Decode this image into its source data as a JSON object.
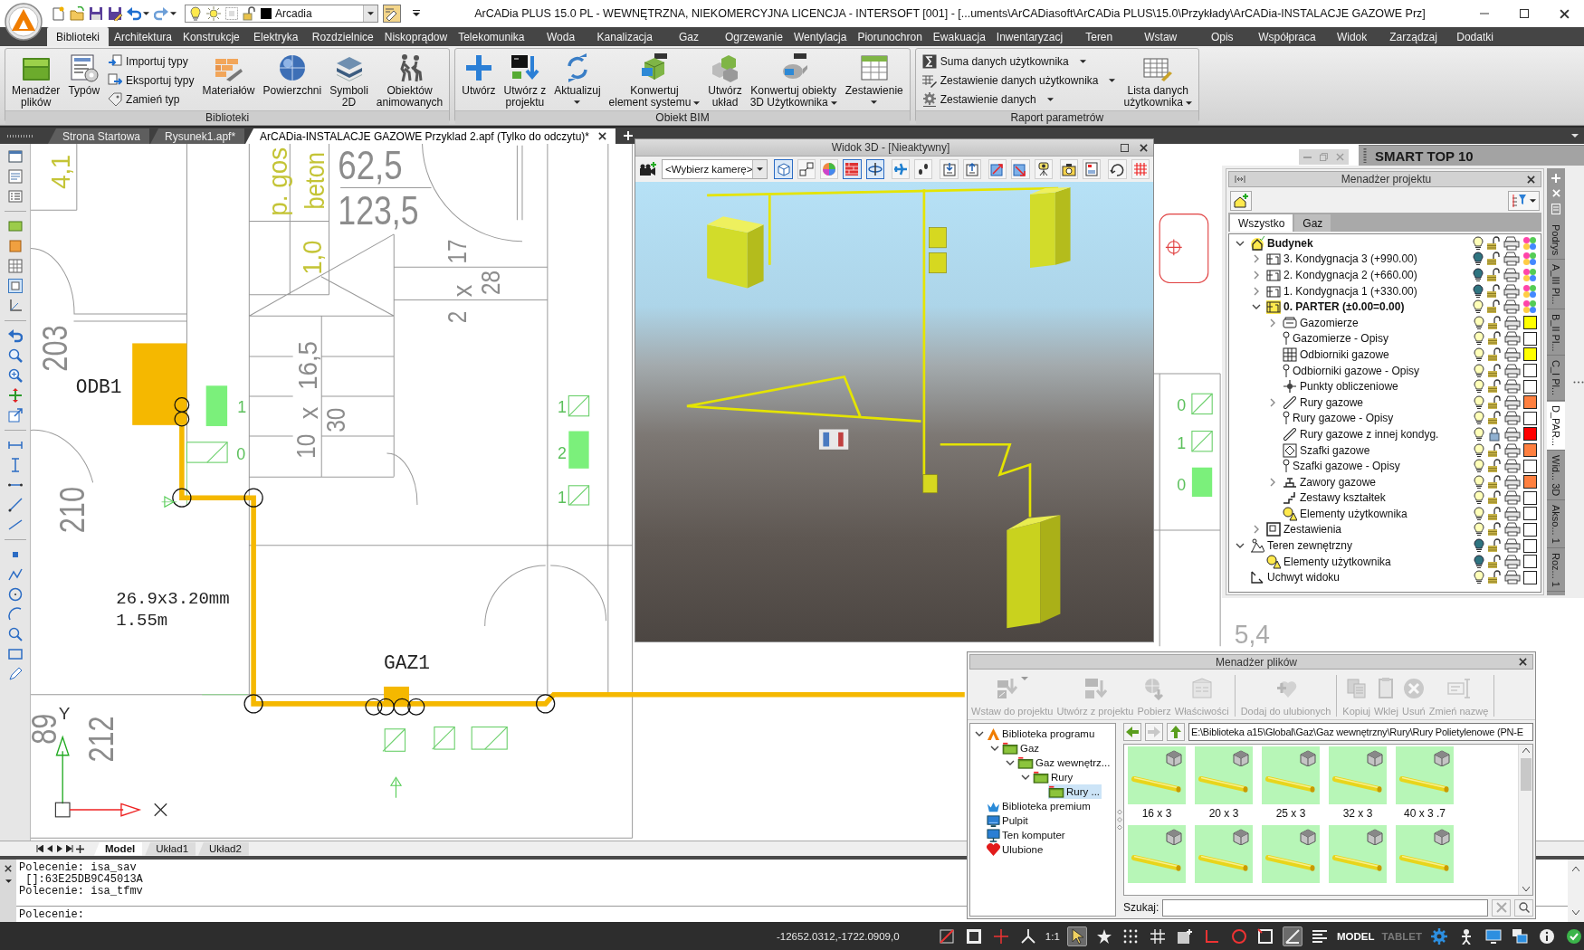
{
  "title_bar": {
    "layer": "Arcadia",
    "title": "ArCADia PLUS 15.0 PL - WEWNĘTRZNA, NIEKOMERCYJNA LICENCJA - INTERSOFT [001] - [...uments\\ArCADiasoft\\ArCADia PLUS\\15.0\\Przykłady\\ArCADia-INSTALACJE GAZOWE Prz]"
  },
  "ribbon": {
    "tabs": [
      {
        "label": "Biblioteki",
        "selected": true
      },
      {
        "label": "Architektura",
        "selected": false
      },
      {
        "label": "Konstrukcje",
        "selected": false
      },
      {
        "label": "Elektryka",
        "selected": false
      },
      {
        "label": "Rozdzielnice",
        "selected": false
      },
      {
        "label": "Niskoprądow",
        "selected": false
      },
      {
        "label": "Telekomunika",
        "selected": false
      },
      {
        "label": "Woda",
        "selected": false
      },
      {
        "label": "Kanalizacja",
        "selected": false
      },
      {
        "label": "Gaz",
        "selected": false
      },
      {
        "label": "Ogrzewanie",
        "selected": false
      },
      {
        "label": "Wentylacja",
        "selected": false
      },
      {
        "label": "Piorunochron",
        "selected": false
      },
      {
        "label": "Ewakuacja",
        "selected": false
      },
      {
        "label": "Inwentaryzacj",
        "selected": false
      },
      {
        "label": "Teren",
        "selected": false
      },
      {
        "label": "Wstaw",
        "selected": false
      },
      {
        "label": "Opis",
        "selected": false
      },
      {
        "label": "Współpraca",
        "selected": false
      },
      {
        "label": "Widok",
        "selected": false
      },
      {
        "label": "Zarządzaj",
        "selected": false
      },
      {
        "label": "Dodatki",
        "selected": false
      }
    ],
    "groups": [
      {
        "title": "Biblioteki",
        "items": [
          {
            "kind": "large",
            "label": "Menadżer\nplików"
          },
          {
            "kind": "large",
            "label": "Typów"
          },
          {
            "kind": "stack",
            "entries": [
              {
                "label": "Importuj typy"
              },
              {
                "label": "Eksportuj typy"
              },
              {
                "label": "Zamień typ"
              }
            ]
          },
          {
            "kind": "large",
            "label": "Materiałów"
          },
          {
            "kind": "large",
            "label": "Powierzchni"
          },
          {
            "kind": "large",
            "label": "Symboli\n2D"
          },
          {
            "kind": "large",
            "label": "Obiektów\nanimowanych"
          }
        ]
      },
      {
        "title": "Obiekt BIM",
        "items": [
          {
            "kind": "large",
            "label": "Utwórz"
          },
          {
            "kind": "large",
            "label": "Utwórz z\nprojektu"
          },
          {
            "kind": "large",
            "label": "Aktualizuj",
            "dropdown": true
          },
          {
            "kind": "large",
            "label": "Konwertuj\nelement systemu",
            "dropdown": true
          },
          {
            "kind": "large",
            "label": "Utwórz\nukład"
          },
          {
            "kind": "large",
            "label": "Konwertuj obiekty\n3D Użytkownika",
            "dropdown": true
          },
          {
            "kind": "large",
            "label": "Zestawienie",
            "dropdown": true
          }
        ]
      },
      {
        "title": "Raport parametrów",
        "items": [
          {
            "kind": "stack",
            "entries": [
              {
                "label": "Suma danych użytkownika",
                "dropdown": true
              },
              {
                "label": "Zestawienie danych użytkownika",
                "dropdown": true
              },
              {
                "label": "Zestawienie danych",
                "dropdown": true
              }
            ]
          },
          {
            "kind": "large",
            "label": "Lista danych\nużytkownika",
            "dropdown": true
          }
        ]
      }
    ]
  },
  "document_tabs": [
    {
      "label": "Strona Startowa",
      "selected": false
    },
    {
      "label": "Rysunek1.apf*",
      "selected": false
    },
    {
      "label": "ArCADia-INSTALACJE GAZOWE Przyklad 2.apf (Tylko do odczytu)*",
      "selected": true
    }
  ],
  "drawing": {
    "labels": [
      {
        "kind": "note",
        "text": "4,1"
      },
      {
        "kind": "area",
        "text": "62,5"
      },
      {
        "kind": "area",
        "text": "123,5"
      },
      {
        "kind": "note",
        "text": "p. gos"
      },
      {
        "kind": "note",
        "text": "beton"
      },
      {
        "kind": "note",
        "text": "1,0"
      },
      {
        "kind": "dimension",
        "text": "17"
      },
      {
        "kind": "dimension",
        "text": "28"
      },
      {
        "kind": "dimension",
        "text": "x"
      },
      {
        "kind": "dimension",
        "text": "2"
      },
      {
        "kind": "dimension",
        "text": "16,5"
      },
      {
        "kind": "dimension",
        "text": "x"
      },
      {
        "kind": "dimension",
        "text": "30"
      },
      {
        "kind": "dimension",
        "text": "10"
      },
      {
        "kind": "large",
        "text": "203"
      },
      {
        "kind": "large",
        "text": "210"
      },
      {
        "kind": "large",
        "text": "212"
      },
      {
        "kind": "large",
        "text": "89"
      },
      {
        "kind": "device",
        "text": "ODB1"
      },
      {
        "kind": "pipe",
        "text": "26.9x3.20mm"
      },
      {
        "kind": "pipe",
        "text": "1.55m"
      },
      {
        "kind": "device",
        "text": "GAZ1"
      },
      {
        "kind": "count",
        "text": "1"
      },
      {
        "kind": "count",
        "text": "0"
      },
      {
        "kind": "count",
        "text": "1"
      },
      {
        "kind": "count",
        "text": "2"
      },
      {
        "kind": "count",
        "text": "1"
      },
      {
        "kind": "count",
        "text": "0"
      },
      {
        "kind": "count",
        "text": "1"
      },
      {
        "kind": "count",
        "text": "0"
      },
      {
        "kind": "axis",
        "text": "Y"
      },
      {
        "kind": "faint",
        "text": "5,4"
      }
    ]
  },
  "view_3d": {
    "title": "Widok 3D - [Nieaktywny]",
    "camera": "<Wybierz kamerę>",
    "tools": [
      {
        "selected": true
      },
      {
        "selected": false
      },
      {
        "selected": false
      },
      {
        "selected": true
      },
      {
        "selected": true
      },
      {
        "selected": false
      },
      {
        "selected": false
      },
      {
        "selected": false
      },
      {
        "selected": false
      },
      {
        "selected": false
      },
      {
        "selected": false
      },
      {
        "selected": false
      },
      {
        "selected": false
      },
      {
        "selected": false
      },
      {
        "selected": false
      },
      {
        "selected": false
      }
    ]
  },
  "smart_panel": {
    "title": "SMART TOP 10"
  },
  "project_manager": {
    "title": "Menadżer projektu",
    "tabs": [
      {
        "label": "Wszystko",
        "selected": true
      },
      {
        "label": "Gaz",
        "selected": false
      }
    ],
    "tree": [
      {
        "label": "Budynek",
        "kind": "building",
        "expanded": true,
        "active": true,
        "lit": true,
        "locked": false,
        "children": [
          {
            "label": "3. Kondygnacja 3 (+990.00)",
            "kind": "floor",
            "expanded": false,
            "active": false,
            "lit": false,
            "locked": false
          },
          {
            "label": "2. Kondygnacja 2 (+660.00)",
            "kind": "floor",
            "expanded": false,
            "active": false,
            "lit": false,
            "locked": false
          },
          {
            "label": "1. Kondygnacja 1 (+330.00)",
            "kind": "floor",
            "expanded": false,
            "active": false,
            "lit": false,
            "locked": false
          },
          {
            "label": "0. PARTER (±0.00=0.00)",
            "kind": "floor",
            "expanded": true,
            "active": true,
            "lit": true,
            "locked": false,
            "children": [
              {
                "label": "Gazomierze",
                "kind": "meter",
                "expanded": false,
                "active": false,
                "lit": true,
                "locked": false,
                "color": "#ffff00"
              },
              {
                "label": "Gazomierze - Opisy",
                "kind": "pin",
                "active": false,
                "lit": true,
                "locked": false,
                "color": "#ffffff"
              },
              {
                "label": "Odbiorniki gazowe",
                "kind": "grid",
                "active": false,
                "lit": true,
                "locked": false,
                "color": "#ffff00"
              },
              {
                "label": "Odbiorniki gazowe - Opisy",
                "kind": "pin",
                "active": false,
                "lit": true,
                "locked": false,
                "color": "#ffffff"
              },
              {
                "label": "Punkty obliczeniowe",
                "kind": "point",
                "active": false,
                "lit": true,
                "locked": false,
                "color": "#ffffff"
              },
              {
                "label": "Rury gazowe",
                "kind": "pipe",
                "expanded": false,
                "active": false,
                "lit": true,
                "locked": false,
                "color": "#ff8040"
              },
              {
                "label": "Rury gazowe - Opisy",
                "kind": "pin",
                "active": false,
                "lit": true,
                "locked": false,
                "color": "#ffffff"
              },
              {
                "label": "Rury gazowe z innej kondyg.",
                "kind": "pipe",
                "active": false,
                "lit": true,
                "locked": true,
                "color": "#ff0000"
              },
              {
                "label": "Szafki gazowe",
                "kind": "cabinet",
                "active": false,
                "lit": true,
                "locked": false,
                "color": "#ff8040"
              },
              {
                "label": "Szafki gazowe - Opisy",
                "kind": "pin",
                "active": false,
                "lit": true,
                "locked": false,
                "color": "#ffffff"
              },
              {
                "label": "Zawory gazowe",
                "kind": "valve",
                "expanded": false,
                "active": false,
                "lit": true,
                "locked": false,
                "color": "#ff8040"
              },
              {
                "label": "Zestawy kształtek",
                "kind": "fittings",
                "active": false,
                "lit": true,
                "locked": false,
                "color": "#ffffff"
              },
              {
                "label": "Elementy użytkownika",
                "kind": "user",
                "active": false,
                "lit": true,
                "locked": false,
                "color": "#ffffff"
              }
            ]
          },
          {
            "label": "Zestawienia",
            "kind": "table",
            "expanded": false,
            "active": false,
            "lit": true,
            "locked": false,
            "color": "#ffffff"
          }
        ]
      },
      {
        "label": "Teren zewnętrzny",
        "kind": "terrain",
        "expanded": true,
        "active": false,
        "lit": false,
        "locked": false,
        "color": "#ffffff",
        "children": [
          {
            "label": "Elementy użytkownika",
            "kind": "user",
            "active": false,
            "lit": false,
            "locked": false,
            "color": "#ffffff"
          }
        ]
      },
      {
        "label": "Uchwyt widoku",
        "kind": "handle",
        "active": false,
        "lit": true,
        "locked": false,
        "color": "#ffffff"
      }
    ],
    "side_tabs": [
      {
        "label": "Podrys",
        "selected": false
      },
      {
        "label": "A_III Pl...",
        "selected": false
      },
      {
        "label": "B_II Pl...",
        "selected": false
      },
      {
        "label": "C_I Pl...",
        "selected": false
      },
      {
        "label": "D_PAR...",
        "selected": true
      },
      {
        "label": "Wid... 3D",
        "selected": false
      },
      {
        "label": "Akso... 1",
        "selected": false
      },
      {
        "label": "Roz... 1",
        "selected": false
      }
    ]
  },
  "file_manager": {
    "title": "Menadżer plików",
    "toolbar": [
      {
        "label": "Wstaw do projektu",
        "disabled": true,
        "dropdown": true
      },
      {
        "label": "Utwórz z projektu",
        "disabled": true
      },
      {
        "label": "Pobierz",
        "disabled": true
      },
      {
        "label": "Właściwości",
        "disabled": true
      },
      {
        "label": "Dodaj do ulubionych",
        "disabled": true
      },
      {
        "label": "Kopiuj",
        "disabled": true
      },
      {
        "label": "Wklej",
        "disabled": true
      },
      {
        "label": "Usuń",
        "disabled": true
      },
      {
        "label": "Zmień nazwę",
        "disabled": true
      }
    ],
    "tree": [
      {
        "label": "Biblioteka programu",
        "kind": "library",
        "expanded": true,
        "selected": false,
        "children": [
          {
            "label": "Gaz",
            "kind": "folder",
            "expanded": true,
            "selected": false,
            "children": [
              {
                "label": "Gaz wewnętrz...",
                "kind": "folder",
                "expanded": true,
                "selected": false,
                "children": [
                  {
                    "label": "Rury",
                    "kind": "folder",
                    "expanded": true,
                    "selected": false,
                    "children": [
                      {
                        "label": "Rury ...",
                        "kind": "folder",
                        "selected": true
                      }
                    ]
                  }
                ]
              }
            ]
          }
        ]
      },
      {
        "label": "Biblioteka premium",
        "kind": "premium",
        "selected": false
      },
      {
        "label": "Pulpit",
        "kind": "desktop",
        "selected": false
      },
      {
        "label": "Ten komputer",
        "kind": "computer",
        "selected": false
      },
      {
        "label": "Ulubione",
        "kind": "favorites",
        "selected": false
      }
    ],
    "nav": [
      {
        "disabled": false
      },
      {
        "disabled": true
      },
      {
        "disabled": false
      }
    ],
    "path": "E:\\Biblioteka a15\\Global\\Gaz\\Gaz wewnętrzny\\Rury\\Rury Polietylenowe (PN-E",
    "thumbnails": [
      {
        "kind": "pipe",
        "label": "16 x 3"
      },
      {
        "kind": "pipe",
        "label": "20 x 3"
      },
      {
        "kind": "pipe",
        "label": "25 x 3"
      },
      {
        "kind": "pipe",
        "label": "32 x 3"
      },
      {
        "kind": "pipe",
        "label": "40 x 3 .7"
      },
      {
        "kind": "pipe"
      },
      {
        "kind": "pipe"
      },
      {
        "kind": "pipe"
      },
      {
        "kind": "pipe"
      },
      {
        "kind": "pipe"
      }
    ],
    "search": {
      "label": "Szukaj:"
    }
  },
  "layout_tabs": [
    {
      "label": "Model",
      "selected": true
    },
    {
      "label": "Układ1",
      "selected": false
    },
    {
      "label": "Układ2",
      "selected": false
    }
  ],
  "command_line": {
    "history": [
      "Polecenie: isa_sav",
      " []:63E25DB9C45013A",
      "Polecenie: isa_tfmv"
    ],
    "prompt": "Polecenie:"
  },
  "status_bar": {
    "coordinates": "-12652.0312,-1722.0909,0",
    "items": [
      {
        "kind": "tool",
        "on": false
      },
      {
        "kind": "tool",
        "on": false
      },
      {
        "kind": "tool",
        "on": false
      },
      {
        "kind": "tool",
        "on": false
      },
      {
        "kind": "text",
        "label": "1:1"
      },
      {
        "kind": "tool",
        "on": true
      },
      {
        "kind": "tool",
        "on": false
      },
      {
        "kind": "tool",
        "on": false
      },
      {
        "kind": "tool",
        "on": false
      },
      {
        "kind": "tool",
        "on": false
      },
      {
        "kind": "tool",
        "on": false
      },
      {
        "kind": "tool",
        "on": false
      },
      {
        "kind": "tool",
        "on": false
      },
      {
        "kind": "tool",
        "on": true
      },
      {
        "kind": "tool",
        "on": false
      },
      {
        "kind": "toggle",
        "label": "MODEL",
        "on": true
      },
      {
        "kind": "toggle",
        "label": "TABLET",
        "on": false
      },
      {
        "kind": "tool",
        "on": false
      },
      {
        "kind": "tool",
        "on": false
      },
      {
        "kind": "tool",
        "on": false
      },
      {
        "kind": "tool",
        "on": false
      },
      {
        "kind": "tool",
        "on": false
      },
      {
        "kind": "tool",
        "on": false
      }
    ]
  }
}
